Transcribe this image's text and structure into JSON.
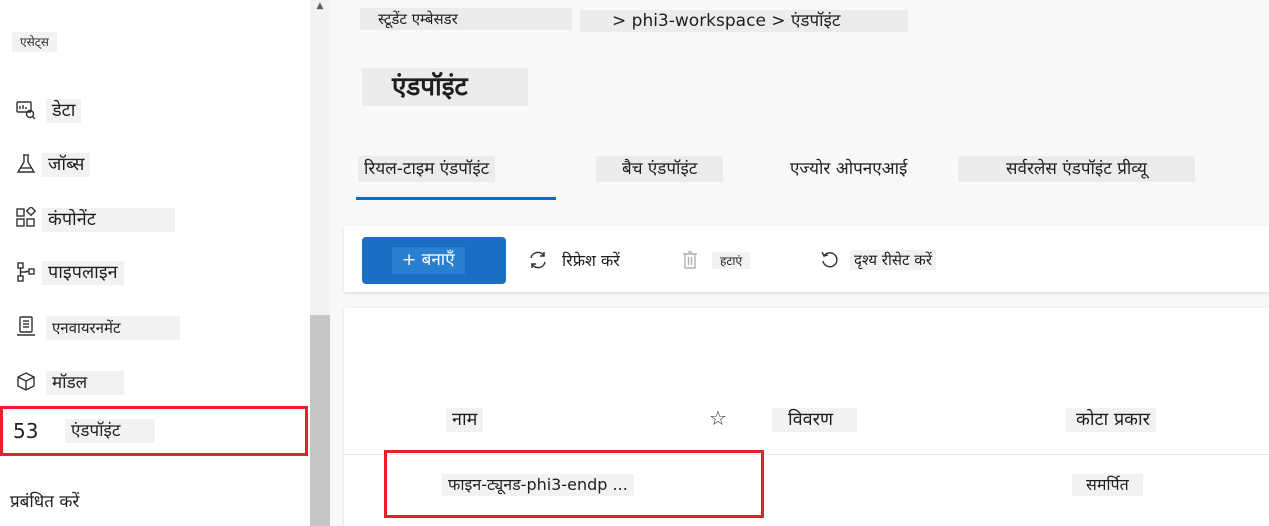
{
  "sidebar": {
    "group_label": "एसेट्स",
    "items": [
      {
        "label": "डेटा",
        "icon": "data-icon"
      },
      {
        "label": "जॉब्स",
        "icon": "flask-icon"
      },
      {
        "label": "कंपोनेंट",
        "icon": "components-icon"
      },
      {
        "label": "पाइपलाइन",
        "icon": "pipeline-icon"
      },
      {
        "label": "एनवायरनमेंट",
        "icon": "environment-icon"
      },
      {
        "label": "मॉडल",
        "icon": "cube-icon"
      },
      {
        "label": "एंडपॉइंट",
        "icon": "endpoint-icon",
        "number": "53",
        "selected": true
      }
    ],
    "manage_label": "प्रबंधित करें"
  },
  "breadcrumb": {
    "root": "स्टूडेंट एम्बेसडर",
    "path": "> phi3-workspace > एंडपॉइंट"
  },
  "page_title": "एंडपॉइंट",
  "tabs": [
    {
      "label": "रियल-टाइम एंडपॉइंट",
      "active": true
    },
    {
      "label": "बैच एंडपॉइंट"
    },
    {
      "label": "एज्योर ओपनएआई"
    },
    {
      "label": "सर्वरलेस एंडपॉइंट प्रीव्यू"
    }
  ],
  "toolbar": {
    "create_label": "+ बनाएँ",
    "refresh_label": "रिफ्रेश करें",
    "delete_label": "हटाएं",
    "reset_view_label": "दृश्य रीसेट करें"
  },
  "table": {
    "columns": {
      "name": "नाम",
      "description": "विवरण",
      "quota_type": "कोटा प्रकार"
    },
    "rows": [
      {
        "name": "फाइन-ट्यूनड-phi3-endp ...",
        "description": "",
        "quota_type": "समर्पित"
      }
    ]
  },
  "colors": {
    "accent": "#0f6cbd",
    "primary_button": "#1a6fc4",
    "highlight_border": "#e8202a"
  }
}
